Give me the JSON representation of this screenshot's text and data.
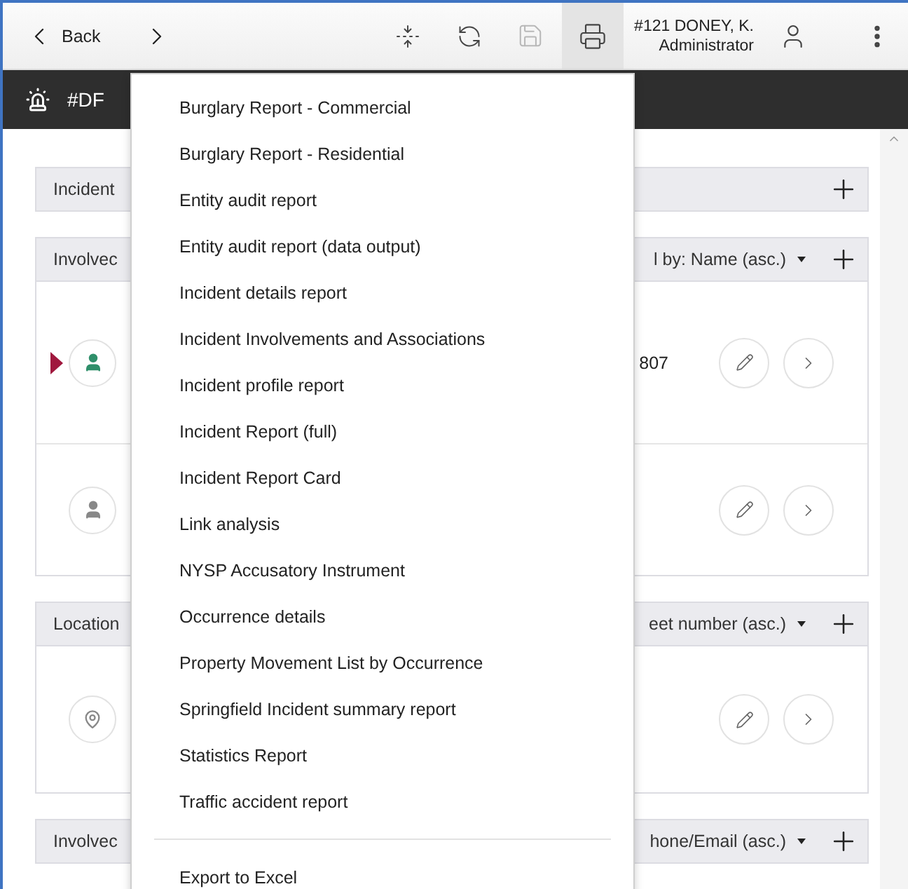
{
  "toolbar": {
    "back_label": "Back",
    "user_name": "#121 DONEY, K.",
    "user_role": "Administrator",
    "print_active": true,
    "save_disabled": true
  },
  "banner": {
    "title": "#DF"
  },
  "sections": [
    {
      "title": "Incident"
    },
    {
      "title": "Involvec",
      "sort": "l by: Name (asc.)",
      "rows": [
        {
          "kind": "person",
          "selected": true,
          "detail": "807"
        },
        {
          "kind": "person",
          "selected": false
        }
      ]
    },
    {
      "title": "Location",
      "sort": "eet number (asc.)",
      "rows": [
        {
          "kind": "location",
          "selected": false
        }
      ]
    },
    {
      "title": "Involvec",
      "sort": "hone/Email (asc.)"
    }
  ],
  "menu": {
    "items": [
      "Burglary Report - Commercial",
      "Burglary Report - Residential",
      "Entity audit report",
      "Entity audit report (data output)",
      "Incident details report",
      "Incident Involvements and Associations",
      "Incident profile report",
      "Incident Report (full)",
      "Incident Report Card",
      "Link analysis",
      "NYSP Accusatory Instrument",
      "Occurrence details",
      "Property Movement List by Occurrence",
      "Springfield Incident summary report",
      "Statistics Report",
      "Traffic accident report"
    ],
    "footer": "Export to Excel"
  }
}
